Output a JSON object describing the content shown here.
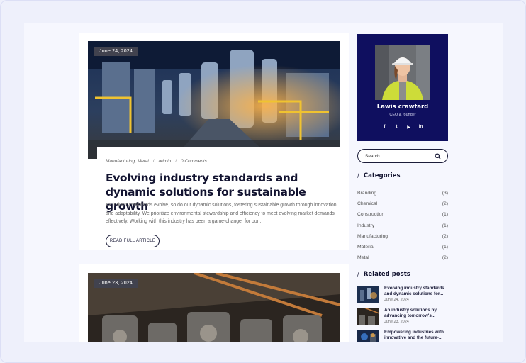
{
  "posts": [
    {
      "date": "June 24, 2024",
      "categories": "Manufacturing, Metal",
      "author": "admin",
      "comments": "0 Comments",
      "title": "Evolving industry standards and dynamic solutions for sustainable growth",
      "excerpt": "As industry standards evolve, so do our dynamic solutions, fostering sustainable growth through innovation and adaptability. We prioritize environmental stewardship and efficiency to meet evolving market demands effectively. Working with this industry has been a game-changer for our...",
      "button_label": "READ FULL ARTICLE"
    },
    {
      "date": "June 23, 2024"
    }
  ],
  "meta_separator": "/",
  "profile": {
    "name": "Lawis crawfard",
    "role": "CEO & founder",
    "socials": [
      {
        "icon": "facebook-icon",
        "glyph": "f"
      },
      {
        "icon": "twitter-icon",
        "glyph": "t"
      },
      {
        "icon": "youtube-icon",
        "glyph": "▶"
      },
      {
        "icon": "linkedin-icon",
        "glyph": "in"
      }
    ]
  },
  "search": {
    "placeholder": "Search ..."
  },
  "categories": {
    "title": "Categories",
    "items": [
      {
        "name": "Branding",
        "count": "(3)"
      },
      {
        "name": "Chemical",
        "count": "(2)"
      },
      {
        "name": "Construction",
        "count": "(1)"
      },
      {
        "name": "Industry",
        "count": "(1)"
      },
      {
        "name": "Manufacturing",
        "count": "(2)"
      },
      {
        "name": "Material",
        "count": "(1)"
      },
      {
        "name": "Metal",
        "count": "(2)"
      }
    ]
  },
  "related": {
    "title": "Related posts",
    "items": [
      {
        "title": "Evolving industry standards and dynamic solutions for...",
        "date": "June 24, 2024"
      },
      {
        "title": "An industry solutions by advancing tomorrow's...",
        "date": "June 23, 2024"
      },
      {
        "title": "Empowering industries with innovative and the future-...",
        "date": ""
      }
    ]
  },
  "widget_slash": "/",
  "colors": {
    "profile_bg": "#0f0f5f",
    "badge_bg": "#41424e",
    "text_dark": "#121330"
  }
}
